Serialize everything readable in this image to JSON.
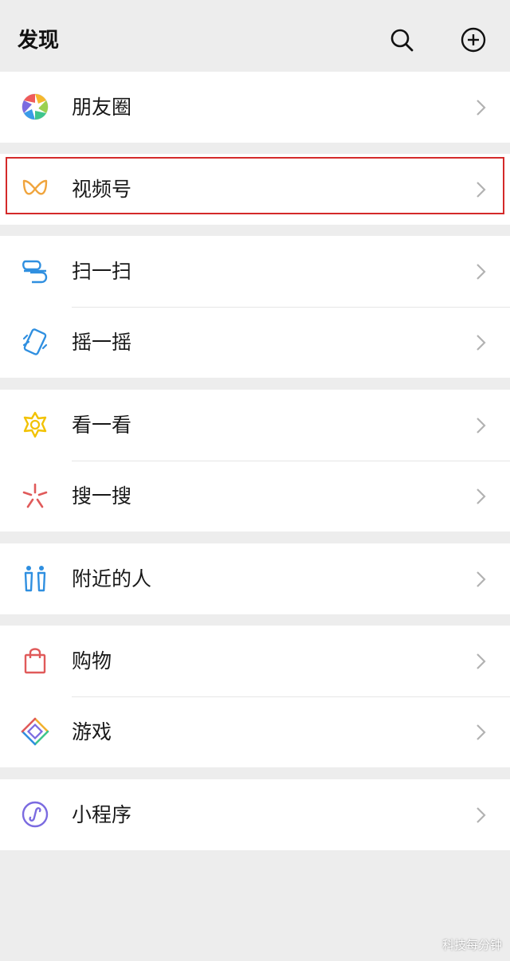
{
  "header": {
    "title": "发现",
    "search_icon": "search-icon",
    "add_icon": "plus-circle-icon"
  },
  "groups": [
    {
      "items": [
        {
          "label": "朋友圈",
          "icon": "moments-aperture-icon"
        }
      ]
    },
    {
      "items": [
        {
          "label": "视频号",
          "icon": "channels-icon"
        }
      ]
    },
    {
      "items": [
        {
          "label": "扫一扫",
          "icon": "scan-icon"
        },
        {
          "label": "摇一摇",
          "icon": "shake-icon"
        }
      ]
    },
    {
      "items": [
        {
          "label": "看一看",
          "icon": "top-stories-icon"
        },
        {
          "label": "搜一搜",
          "icon": "search-spark-icon"
        }
      ]
    },
    {
      "items": [
        {
          "label": "附近的人",
          "icon": "people-nearby-icon"
        }
      ]
    },
    {
      "items": [
        {
          "label": "购物",
          "icon": "shopping-bag-icon"
        },
        {
          "label": "游戏",
          "icon": "games-icon"
        }
      ]
    },
    {
      "items": [
        {
          "label": "小程序",
          "icon": "mini-programs-icon"
        }
      ]
    }
  ],
  "highlight_color": "#d42a2a",
  "watermark": "科技每分钟"
}
